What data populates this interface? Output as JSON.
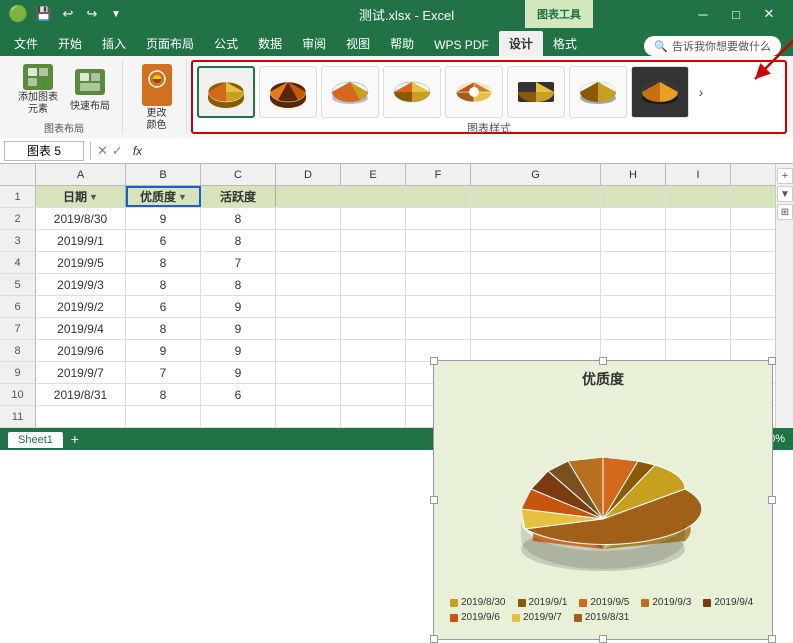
{
  "titleBar": {
    "filename": "测试.xlsx  -  Excel",
    "chartTools": "图表工具",
    "quickAccess": [
      "💾",
      "↩",
      "↪",
      "▼"
    ]
  },
  "ribbon": {
    "tabs": [
      "文件",
      "开始",
      "插入",
      "页面布局",
      "公式",
      "数据",
      "审阅",
      "视图",
      "帮助",
      "WPS PDF",
      "设计",
      "格式"
    ],
    "activeTab": "设计",
    "searchPlaceholder": "告诉我你想要做什么",
    "groups": {
      "layout": "图表布局",
      "addElement": "添加图表\n元素",
      "quickLayout": "快速布局",
      "changeColor": "更改\n颜色",
      "chartStyles": "图表样式"
    }
  },
  "formulaBar": {
    "nameBox": "图表 5",
    "fxLabel": "fx",
    "icons": [
      "✕",
      "✓"
    ]
  },
  "columns": {
    "headers": [
      "A",
      "B",
      "C",
      "D",
      "E",
      "F",
      "G",
      "H",
      "I"
    ]
  },
  "rows": [
    {
      "num": "1",
      "a": "日期",
      "b": "优质度",
      "c": "活跃度"
    },
    {
      "num": "2",
      "a": "2019/8/30",
      "b": "9",
      "c": "8"
    },
    {
      "num": "3",
      "a": "2019/9/1",
      "b": "6",
      "c": "8"
    },
    {
      "num": "4",
      "a": "2019/9/5",
      "b": "8",
      "c": "7"
    },
    {
      "num": "5",
      "a": "2019/9/3",
      "b": "8",
      "c": "8"
    },
    {
      "num": "6",
      "a": "2019/9/2",
      "b": "6",
      "c": "9"
    },
    {
      "num": "7",
      "a": "2019/9/4",
      "b": "8",
      "c": "9"
    },
    {
      "num": "8",
      "a": "2019/9/6",
      "b": "9",
      "c": "9"
    },
    {
      "num": "9",
      "a": "2019/9/7",
      "b": "7",
      "c": "9"
    },
    {
      "num": "10",
      "a": "2019/8/31",
      "b": "8",
      "c": "6"
    },
    {
      "num": "11",
      "a": "",
      "b": "",
      "c": ""
    }
  ],
  "chart": {
    "title": "优质度",
    "legend": [
      {
        "label": "2019/8/30",
        "color": "#c8a020"
      },
      {
        "label": "2019/9/1",
        "color": "#8b5a00"
      },
      {
        "label": "2019/9/5",
        "color": "#d4691e"
      },
      {
        "label": "2019/9/3",
        "color": "#b87020"
      },
      {
        "label": "2019/9/4",
        "color": "#7b3a10"
      },
      {
        "label": "2019/9/6",
        "color": "#c8550a"
      },
      {
        "label": "2019/9/7",
        "color": "#e8a030"
      },
      {
        "label": "2019/8/31",
        "color": "#a06018"
      }
    ],
    "slices": [
      {
        "color": "#c8a020",
        "value": 9
      },
      {
        "color": "#8b5a00",
        "value": 6
      },
      {
        "color": "#d4691e",
        "value": 8
      },
      {
        "color": "#b87020",
        "value": 8
      },
      {
        "color": "#7b5020",
        "value": 6
      },
      {
        "color": "#7b3a10",
        "value": 8
      },
      {
        "color": "#c8550a",
        "value": 9
      },
      {
        "color": "#e8c040",
        "value": 7
      },
      {
        "color": "#a06018",
        "value": 8
      }
    ]
  },
  "bottomBar": {
    "sheetTab": "Sheet1"
  },
  "arrow": {
    "text": "↑"
  }
}
